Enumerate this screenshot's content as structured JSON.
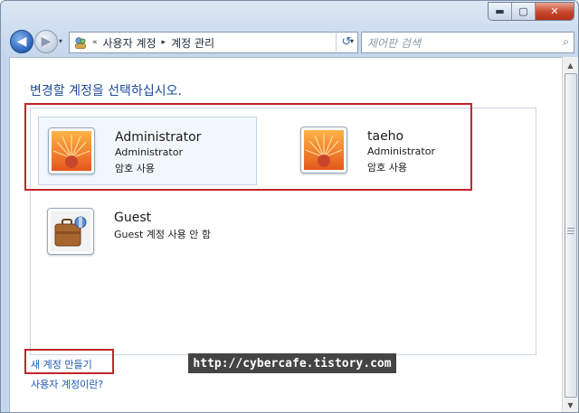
{
  "titlebar": {
    "buttons": [
      {
        "name": "minimize-button",
        "glyph": "▬"
      },
      {
        "name": "maximize-button",
        "glyph": "▢"
      },
      {
        "name": "close-button",
        "glyph": "✕"
      }
    ]
  },
  "nav": {
    "back_glyph": "◀",
    "forward_glyph": "▶",
    "history_glyph": "▾",
    "breadcrumb_prefix": "«",
    "breadcrumbs": [
      "사용자 계정",
      "계정 관리"
    ],
    "separator": "▸",
    "address_dropdown": "▾",
    "refresh_glyph": "↺",
    "search_placeholder": "제어판 검색",
    "search_glyph": "⌕"
  },
  "main": {
    "heading": "변경할 계정을 선택하십시오.",
    "accounts": [
      {
        "name": "Administrator",
        "type": "Administrator",
        "status": "암호 사용",
        "avatar": "flower-avatar"
      },
      {
        "name": "taeho",
        "type": "Administrator",
        "status": "암호 사용",
        "avatar": "flower-avatar"
      },
      {
        "name": "Guest",
        "type": "Guest 계정 사용 안 함",
        "status": "",
        "avatar": "briefcase-avatar"
      }
    ],
    "create_account_link": "새 계정 만들기",
    "what_is_account_link": "사용자 계정이란?"
  },
  "watermark": "http://cybercafe.tistory.com",
  "scrollbar": {
    "up": "▲",
    "down": "▼"
  },
  "colors": {
    "heading": "#1e4b9a",
    "link": "#1f58b5",
    "highlight_box": "#c0262d",
    "selected_tile": "#f2f7fd"
  }
}
